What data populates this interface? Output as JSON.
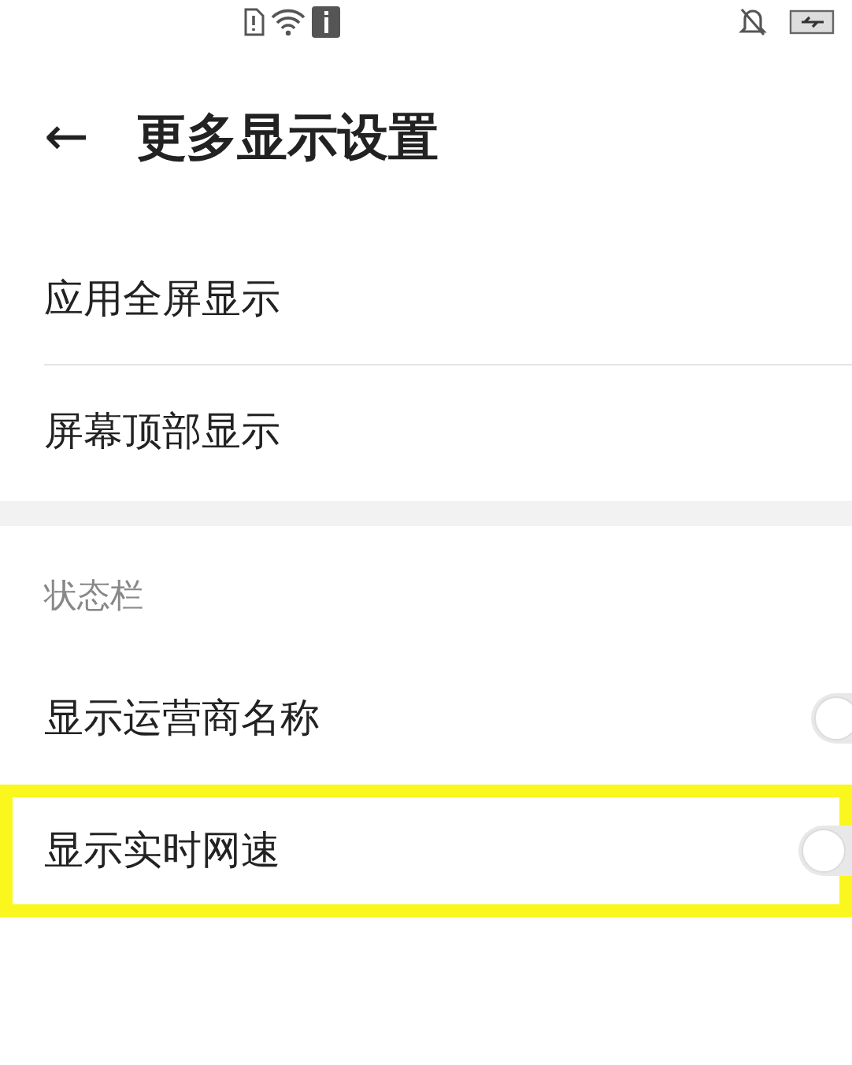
{
  "header": {
    "back": "←",
    "title": "更多显示设置"
  },
  "items": [
    {
      "label": "应用全屏显示"
    },
    {
      "label": "屏幕顶部显示"
    }
  ],
  "section": {
    "title": "状态栏",
    "items": [
      {
        "label": "显示运营商名称",
        "on": false,
        "highlighted": false
      },
      {
        "label": "显示实时网速",
        "on": false,
        "highlighted": true
      }
    ]
  }
}
